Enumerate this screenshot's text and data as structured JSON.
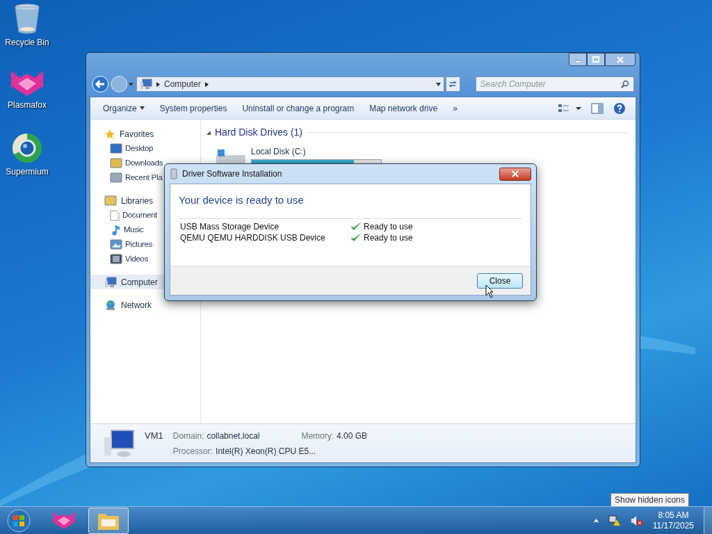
{
  "desktop_icons": [
    {
      "label": "Recycle Bin",
      "kind": "bin"
    },
    {
      "label": "Plasmafox",
      "kind": "fox"
    },
    {
      "label": "Supermium",
      "kind": "browser"
    }
  ],
  "explorer": {
    "address": [
      "Computer"
    ],
    "search": {
      "placeholder": "Search Computer"
    },
    "toolbar": [
      {
        "label": "Organize",
        "kind": "menu"
      },
      {
        "label": "System properties",
        "kind": "plain"
      },
      {
        "label": "Uninstall or change a program",
        "kind": "plain"
      },
      {
        "label": "Map network drive",
        "kind": "plain"
      },
      {
        "label": "»",
        "kind": "plain"
      }
    ],
    "sidebar": [
      {
        "label": "Favorites",
        "kind": "star",
        "selected": false,
        "children": [
          {
            "label": "Desktop",
            "kind": "desktop",
            "selected": false
          },
          {
            "label": "Downloads",
            "kind": "downloads",
            "selected": false
          },
          {
            "label": "Recent Pla",
            "kind": "recent",
            "selected": false
          }
        ]
      },
      {
        "label": "Libraries",
        "kind": "library",
        "selected": false,
        "children": [
          {
            "label": "Document",
            "kind": "document",
            "selected": false
          },
          {
            "label": "Music",
            "kind": "music",
            "selected": false
          },
          {
            "label": "Pictures",
            "kind": "pictures",
            "selected": false
          },
          {
            "label": "Videos",
            "kind": "videos",
            "selected": false
          }
        ]
      },
      {
        "label": "Computer",
        "kind": "computer",
        "selected": true
      },
      {
        "label": "Network",
        "kind": "network",
        "selected": false
      }
    ],
    "section": {
      "title": "Hard Disk Drives (1)",
      "drives": [
        {
          "label": "Local Disk (C:)",
          "level": 0.79
        }
      ]
    },
    "details": {
      "name": "VM1",
      "fields": [
        {
          "label": "Domain:",
          "value": "collabnet.local"
        },
        {
          "label": "Memory:",
          "value": "4.00 GB"
        },
        {
          "label": "Processor:",
          "value": "Intel(R) Xeon(R) CPU E5..."
        }
      ]
    }
  },
  "dialog": {
    "title": "Driver Software Installation",
    "heading": "Your device is ready to use",
    "devices": [
      {
        "name": "USB Mass Storage Device",
        "status": "Ready to use"
      },
      {
        "name": "QEMU QEMU HARDDISK USB Device",
        "status": "Ready to use"
      }
    ],
    "button": "Close"
  },
  "taskbar": {
    "apps": [
      {
        "kind": "fox",
        "selected": false
      },
      {
        "kind": "folder",
        "selected": true
      }
    ],
    "time": "8:05 AM",
    "date": "11/17/2025",
    "tooltip": "Show hidden icons"
  }
}
